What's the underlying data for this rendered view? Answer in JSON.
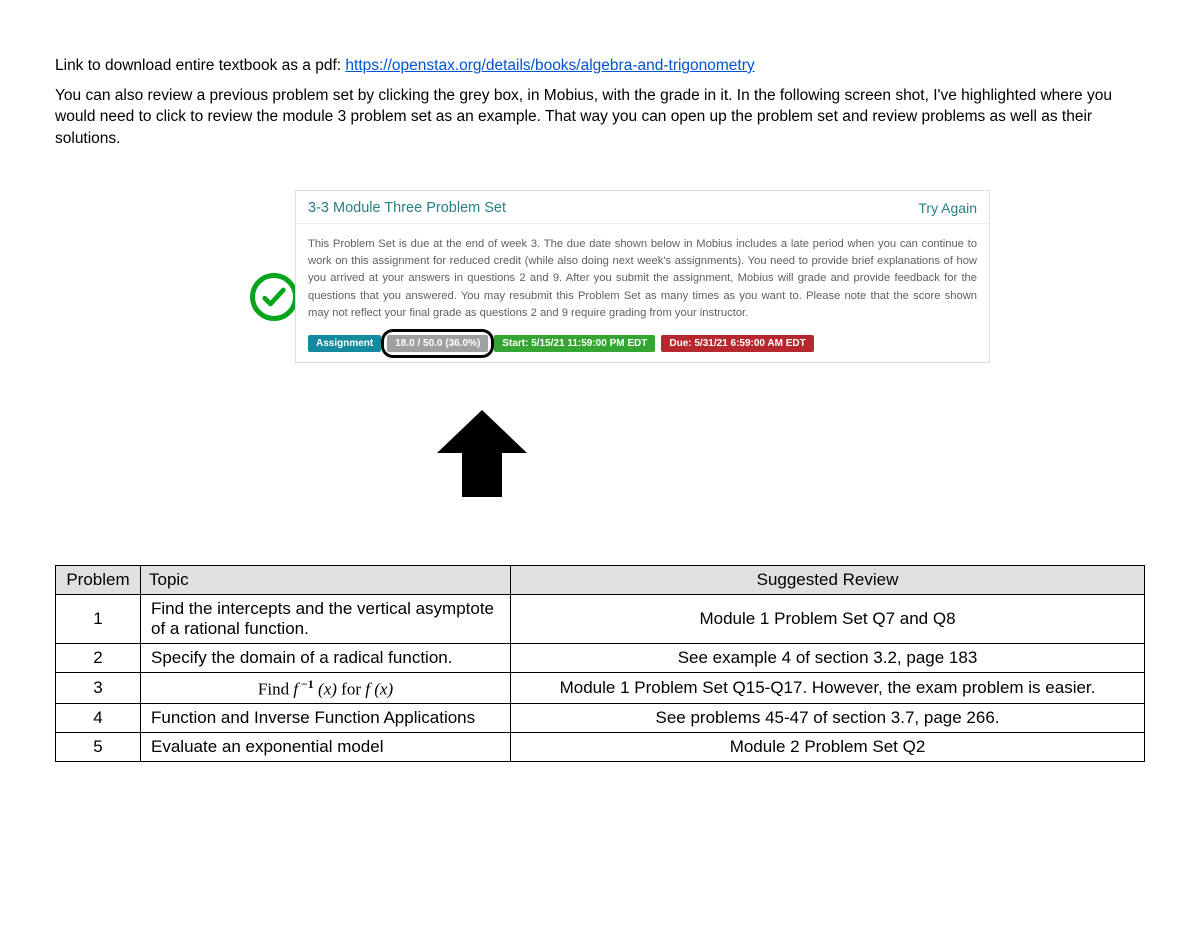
{
  "intro": {
    "prefix": "Link to download entire textbook as a pdf: ",
    "link_text": "https://openstax.org/details/books/algebra-and-trigonometry",
    "link_href": "https://openstax.org/details/books/algebra-and-trigonometry",
    "para2": "You can also review a previous problem set by clicking the grey box, in Mobius, with the grade in it. In the following screen shot, I've highlighted where you would need to click to review the module 3 problem set as an example. That way you can open up the problem set and review problems as well as their solutions."
  },
  "card": {
    "title": "3-3 Module Three Problem Set",
    "try_again": "Try Again",
    "body": "This Problem Set is due at the end of week 3. The due date shown below in Mobius includes a late period when you can continue to work on this assignment for reduced credit (while also doing next week's assignments). You need to provide brief explanations of how you arrived at your answers in questions 2 and 9. After you submit the assignment, Mobius will grade and provide feedback for the questions that you answered. You may resubmit this Problem Set as many times as you want to. Please note that the score shown may not reflect your final grade as questions 2 and 9 require grading from your instructor.",
    "pill_assignment": "Assignment",
    "pill_score": "18.0 / 50.0 (36.0%)",
    "pill_start": "Start: 5/15/21 11:59:00 PM EDT",
    "pill_due": "Due: 5/31/21 6:59:00 AM EDT"
  },
  "table": {
    "headers": {
      "problem": "Problem",
      "topic": "Topic",
      "review": "Suggested Review"
    },
    "rows": [
      {
        "n": "1",
        "topic": "Find the intercepts and the vertical asymptote of a rational function.",
        "review": "Module 1 Problem Set Q7 and Q8"
      },
      {
        "n": "2",
        "topic": "Specify the domain of a radical function.",
        "review": "See example 4 of section 3.2, page 183"
      },
      {
        "n": "3",
        "topic_math": true,
        "review": "Module 1 Problem Set Q15-Q17. However, the exam problem is easier."
      },
      {
        "n": "4",
        "topic": "Function and Inverse Function Applications",
        "review": "See problems 45-47 of section 3.7, page 266."
      },
      {
        "n": "5",
        "topic": "Evaluate an exponential model",
        "review": "Module 2 Problem Set Q2"
      }
    ]
  }
}
